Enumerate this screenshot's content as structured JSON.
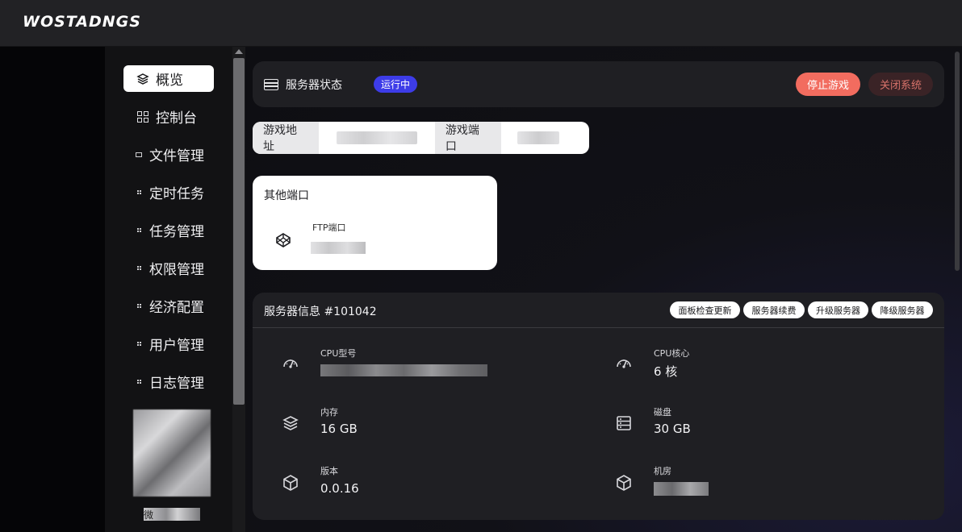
{
  "app": {
    "logo": "WOSTADNGS"
  },
  "sidebar": {
    "items": [
      {
        "label": "概览",
        "icon": "layers-icon",
        "active": true
      },
      {
        "label": "控制台",
        "icon": "grid-icon"
      },
      {
        "label": "文件管理",
        "icon": "file-icon"
      },
      {
        "label": "定时任务",
        "icon": "dots-icon"
      },
      {
        "label": "任务管理",
        "icon": "dots-icon"
      },
      {
        "label": "权限管理",
        "icon": "dots-icon"
      },
      {
        "label": "经济配置",
        "icon": "dots-icon"
      },
      {
        "label": "用户管理",
        "icon": "dots-icon"
      },
      {
        "label": "日志管理",
        "icon": "dots-icon"
      }
    ],
    "username": "微"
  },
  "status": {
    "title": "服务器状态",
    "badge": "运行中",
    "stop_label": "停止游戏",
    "shutdown_label": "关闭系统"
  },
  "address": {
    "game_address_label": "游戏地址",
    "game_port_label": "游戏端口"
  },
  "ports": {
    "title": "其他端口",
    "ftp_label": "FTP端口"
  },
  "info": {
    "title": "服务器信息 #101042",
    "buttons": [
      "面板检查更新",
      "服务器续费",
      "升级服务器",
      "降级服务器"
    ],
    "specs": {
      "cpu_model_label": "CPU型号",
      "cpu_cores_label": "CPU核心",
      "cpu_cores_value": "6 核",
      "memory_label": "内存",
      "memory_value": "16 GB",
      "disk_label": "磁盘",
      "disk_value": "30 GB",
      "version_label": "版本",
      "version_value": "0.0.16",
      "room_label": "机房"
    }
  },
  "colors": {
    "accent_badge": "#3d3ce8",
    "stop_button": "#f26c5f",
    "shutdown_text": "#d7726a"
  }
}
